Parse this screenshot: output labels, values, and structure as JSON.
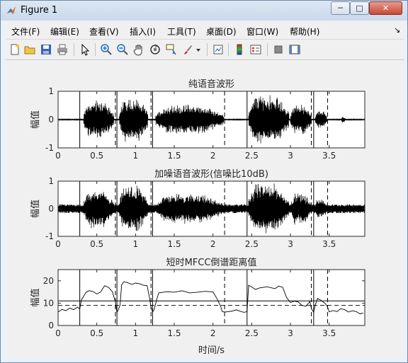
{
  "window": {
    "title": "Figure 1",
    "min_label": "─",
    "max_label": "□",
    "close_label": "✕"
  },
  "menu": {
    "items": [
      {
        "label": "文件(F)"
      },
      {
        "label": "编辑(E)"
      },
      {
        "label": "查看(V)"
      },
      {
        "label": "插入(I)"
      },
      {
        "label": "工具(T)"
      },
      {
        "label": "桌面(D)"
      },
      {
        "label": "窗口(W)"
      },
      {
        "label": "帮助(H)"
      }
    ],
    "arrow": "↘"
  },
  "toolbar": {
    "icons": [
      "new-figure-icon",
      "open-file-icon",
      "save-icon",
      "print-icon",
      "select-pointer-icon",
      "zoom-in-icon",
      "zoom-out-icon",
      "pan-hand-icon",
      "rotate-3d-icon",
      "data-cursor-icon",
      "brush-icon",
      "brush-dropdown-icon",
      "link-plot-icon",
      "colorbar-icon",
      "legend-icon",
      "hide-plot-tools-icon",
      "show-plot-tools-icon"
    ]
  },
  "figure": {
    "colors": {
      "background": "#f0f0f0",
      "axes": "#ffffff",
      "line": "#000000"
    },
    "xlabel": "时间/s",
    "boundaries_solid": [
      0.28,
      0.76,
      1.22,
      2.44,
      3.3
    ],
    "boundaries_dashed": [
      0.74,
      1.2,
      2.15,
      3.27,
      3.48
    ],
    "subplots": [
      {
        "title": "纯语音波形",
        "ylabel": "幅值",
        "type": "line",
        "xlim": [
          0,
          3.96
        ],
        "ylim": [
          -1,
          1
        ],
        "xticks": [
          "0",
          "0.5",
          "1",
          "1.5",
          "2",
          "2.5",
          "3",
          "3.5"
        ],
        "yticks": [
          "1",
          "0",
          "-1"
        ],
        "noise": 0.015,
        "segments": [
          {
            "from": 0.33,
            "to": 0.72,
            "amp": 0.7
          },
          {
            "from": 0.79,
            "to": 1.16,
            "amp": 0.82
          },
          {
            "from": 1.26,
            "to": 2.14,
            "amp": 0.55
          },
          {
            "from": 2.46,
            "to": 2.98,
            "amp": 0.92
          },
          {
            "from": 3.0,
            "to": 3.27,
            "amp": 0.55
          },
          {
            "from": 3.32,
            "to": 3.47,
            "amp": 0.35
          },
          {
            "from": 3.66,
            "to": 3.71,
            "amp": 0.12
          }
        ]
      },
      {
        "title": "加噪语音波形(信噪比10dB)",
        "ylabel": "幅值",
        "type": "line",
        "xlim": [
          0,
          3.96
        ],
        "ylim": [
          -1,
          1
        ],
        "xticks": [
          "0",
          "0.5",
          "1",
          "1.5",
          "2",
          "2.5",
          "3",
          "3.5"
        ],
        "yticks": [
          "1",
          "0",
          "-1"
        ],
        "noise": 0.16,
        "segments": [
          {
            "from": 0.33,
            "to": 0.72,
            "amp": 0.72
          },
          {
            "from": 0.79,
            "to": 1.16,
            "amp": 0.88
          },
          {
            "from": 1.26,
            "to": 2.14,
            "amp": 0.58
          },
          {
            "from": 2.46,
            "to": 2.98,
            "amp": 0.97
          },
          {
            "from": 3.0,
            "to": 3.27,
            "amp": 0.6
          },
          {
            "from": 3.32,
            "to": 3.47,
            "amp": 0.4
          }
        ]
      },
      {
        "title": "短时MFCC倒谱距离值",
        "ylabel": "幅值",
        "type": "line",
        "xlim": [
          0,
          3.96
        ],
        "ylim": [
          0,
          25
        ],
        "xticks": [
          "0",
          "0.5",
          "1",
          "1.5",
          "2",
          "2.5",
          "3",
          "3.5"
        ],
        "yticks": [
          "20",
          "10",
          "0"
        ],
        "threshold_solid": 11,
        "threshold_dashed": 9,
        "series": {
          "x": [
            0.0,
            0.05,
            0.1,
            0.15,
            0.2,
            0.25,
            0.28,
            0.3,
            0.32,
            0.36,
            0.4,
            0.45,
            0.5,
            0.55,
            0.6,
            0.65,
            0.7,
            0.74,
            0.76,
            0.78,
            0.8,
            0.82,
            0.85,
            0.9,
            0.95,
            1.0,
            1.05,
            1.1,
            1.15,
            1.18,
            1.2,
            1.22,
            1.24,
            1.27,
            1.3,
            1.4,
            1.5,
            1.6,
            1.7,
            1.8,
            1.9,
            2.0,
            2.05,
            2.1,
            2.12,
            2.15,
            2.2,
            2.25,
            2.3,
            2.35,
            2.4,
            2.44,
            2.46,
            2.5,
            2.55,
            2.6,
            2.7,
            2.8,
            2.85,
            2.9,
            2.95,
            3.0,
            3.05,
            3.1,
            3.15,
            3.2,
            3.25,
            3.27,
            3.3,
            3.32,
            3.35,
            3.4,
            3.45,
            3.48,
            3.5,
            3.55,
            3.6,
            3.65,
            3.7,
            3.75,
            3.8,
            3.85,
            3.9,
            3.94
          ],
          "y": [
            6,
            7.2,
            6.6,
            7.8,
            7.1,
            8.2,
            7.4,
            11.4,
            12.5,
            14.8,
            15.6,
            15.2,
            14.1,
            15.0,
            17.8,
            17.1,
            15.2,
            10.6,
            5.8,
            7.2,
            9.1,
            18.2,
            19.6,
            19.1,
            18.4,
            19.0,
            18.7,
            18.0,
            17.8,
            12.6,
            8.2,
            6.0,
            7.1,
            11.2,
            14.6,
            15.1,
            14.9,
            15.5,
            14.6,
            14.9,
            15.3,
            15.0,
            12.1,
            8.5,
            6.2,
            6.0,
            6.2,
            6.5,
            7.0,
            6.4,
            5.9,
            6.2,
            18.0,
            17.2,
            16.1,
            16.8,
            17.3,
            16.5,
            17.6,
            17.1,
            12.5,
            10.3,
            10.9,
            10.5,
            9.0,
            8.6,
            10.7,
            7.6,
            5.9,
            9.1,
            12.1,
            11.1,
            9.8,
            8.3,
            6.1,
            6.7,
            6.2,
            7.5,
            7.1,
            6.0,
            6.6,
            6.2,
            5.2,
            5.6
          ]
        }
      }
    ]
  }
}
